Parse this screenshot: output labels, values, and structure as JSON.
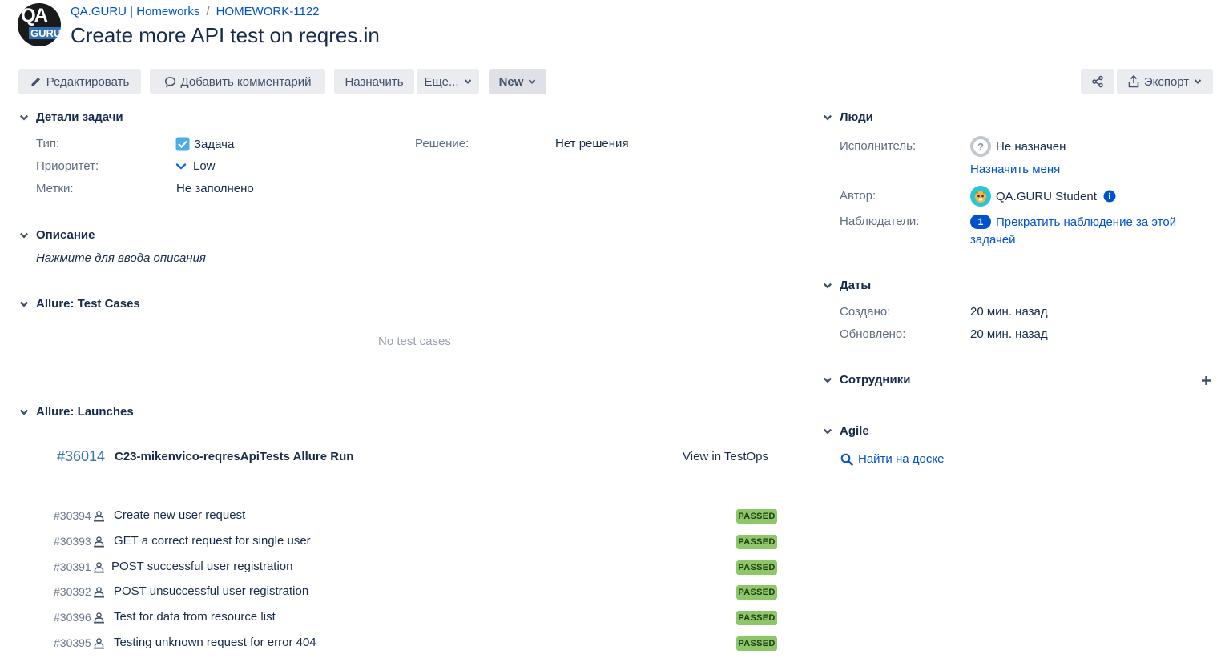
{
  "header": {
    "logo_top": "QA",
    "logo_bottom": "GURU",
    "breadcrumb_project": "QA.GURU | Homeworks",
    "breadcrumb_sep": "/",
    "breadcrumb_issue": "HOMEWORK-1122",
    "title": "Create more API test on reqres.in"
  },
  "toolbar": {
    "edit": "Редактировать",
    "comment": "Добавить комментарий",
    "assign": "Назначить",
    "more": "Еще...",
    "status": "New",
    "export": "Экспорт"
  },
  "details": {
    "header": "Детали задачи",
    "type_label": "Тип:",
    "type_value": "Задача",
    "priority_label": "Приоритет:",
    "priority_value": "Low",
    "labels_label": "Метки:",
    "labels_value": "Не заполнено",
    "resolution_label": "Решение:",
    "resolution_value": "Нет решения"
  },
  "description": {
    "header": "Описание",
    "placeholder": "Нажмите для ввода описания"
  },
  "test_cases": {
    "header": "Allure: Test Cases",
    "empty": "No test cases"
  },
  "launches": {
    "header": "Allure: Launches",
    "launch_id": "#36014",
    "launch_name": "C23-mikenvico-reqresApiTests Allure Run",
    "view_link": "View in TestOps",
    "rows": [
      {
        "id": "#30394",
        "name": "Create new user request",
        "status": "PASSED"
      },
      {
        "id": "#30393",
        "name": "GET a correct request for single user",
        "status": "PASSED"
      },
      {
        "id": "#30391",
        "name": "POST successful user registration",
        "status": "PASSED"
      },
      {
        "id": "#30392",
        "name": "POST unsuccessful user registration",
        "status": "PASSED"
      },
      {
        "id": "#30396",
        "name": "Test for data from resource list",
        "status": "PASSED"
      },
      {
        "id": "#30395",
        "name": "Testing unknown request for error 404",
        "status": "PASSED"
      }
    ]
  },
  "people": {
    "header": "Люди",
    "assignee_label": "Исполнитель:",
    "assignee_value": "Не назначен",
    "assign_me": "Назначить меня",
    "reporter_label": "Автор:",
    "reporter_value": "QA.GURU Student",
    "watchers_label": "Наблюдатели:",
    "watchers_count": "1",
    "watch_line1": "Прекратить наблюдение за этой",
    "watch_line2": "задачей"
  },
  "dates": {
    "header": "Даты",
    "created_label": "Создано:",
    "created_value": "20 мин. назад",
    "updated_label": "Обновлено:",
    "updated_value": "20 мин. назад"
  },
  "staff": {
    "header": "Сотрудники"
  },
  "agile": {
    "header": "Agile",
    "find_on_board": "Найти на доске"
  },
  "colors": {
    "link": "#0052cc",
    "passed": "#8ec76a",
    "button_bg": "#ebecf0",
    "text": "#172b4d"
  }
}
